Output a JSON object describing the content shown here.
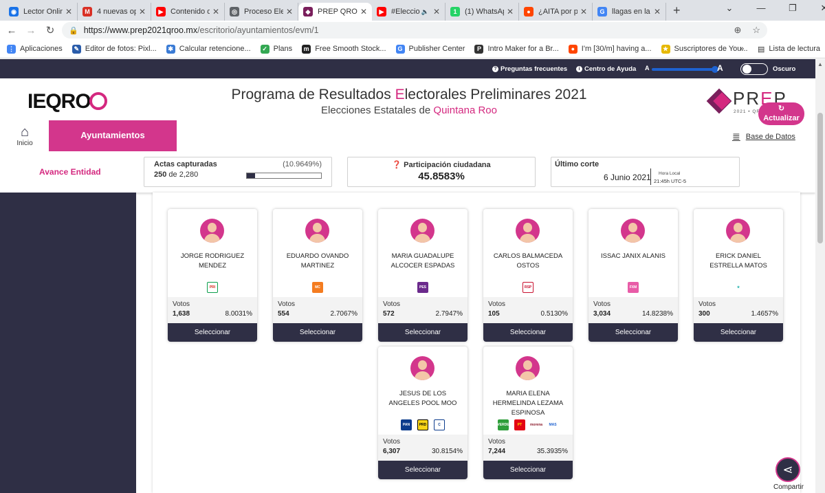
{
  "browser": {
    "tabs": [
      {
        "title": "Lector Onlin",
        "color": "#1a73e8",
        "glyph": "◉"
      },
      {
        "title": "4 nuevas op",
        "color": "#d93025",
        "glyph": "M"
      },
      {
        "title": "Contenido d",
        "color": "#ff0000",
        "glyph": "▶"
      },
      {
        "title": "Proceso Elec",
        "color": "#5f6368",
        "glyph": "◎"
      },
      {
        "title": "PREP QROO",
        "color": "#7a1f5c",
        "glyph": "◆",
        "active": true
      },
      {
        "title": "#Eleccio",
        "color": "#ff0000",
        "glyph": "▶",
        "audio": "🔈"
      },
      {
        "title": "(1) WhatsAp",
        "color": "#25d366",
        "glyph": "1"
      },
      {
        "title": "¿AITA por p",
        "color": "#ff4500",
        "glyph": "●"
      },
      {
        "title": "llagas en la",
        "color": "#4285f4",
        "glyph": "G"
      }
    ],
    "url_host": "https://www.prep2021qroo.mx",
    "url_path": "/escritorio/ayuntamientos/evm/1",
    "bookmarks": [
      {
        "label": "Aplicaciones",
        "color": "#4285f4",
        "glyph": "⋮"
      },
      {
        "label": "Editor de fotos: Pixl...",
        "color": "#2a5caa",
        "glyph": "✎"
      },
      {
        "label": "Calcular retencione...",
        "color": "#3a7bd5",
        "glyph": "✱"
      },
      {
        "label": "Plans",
        "color": "#34a853",
        "glyph": "✓"
      },
      {
        "label": "Free Smooth Stock...",
        "color": "#222222",
        "glyph": "m"
      },
      {
        "label": "Publisher Center",
        "color": "#4285f4",
        "glyph": "G"
      },
      {
        "label": "Intro Maker for a Br...",
        "color": "#333333",
        "glyph": "P"
      },
      {
        "label": "I'm [30/m] having a...",
        "color": "#ff4500",
        "glyph": "●"
      },
      {
        "label": "Suscriptores de You...",
        "color": "#e6b800",
        "glyph": "★"
      }
    ],
    "reading_list": "Lista de lectura"
  },
  "topbar": {
    "faq": "Preguntas frecuentes",
    "help": "Centro de Ayuda",
    "font_small": "A",
    "font_large": "A",
    "dark_mode": "Oscuro"
  },
  "header": {
    "logo_text": "IEQRO",
    "title_a": "Programa de Resultados ",
    "title_b": "E",
    "title_c": "lectorales Preliminares 2021",
    "subtitle_a": "Elecciones Estatales de ",
    "subtitle_b": "Quintana Roo",
    "prep_a": "PR",
    "prep_b": "E",
    "prep_c": "P",
    "prep_small": "2021 • QROO"
  },
  "nav": {
    "home": "Inicio",
    "ayuntamientos": "Ayuntamientos",
    "base_datos": "Base de Datos"
  },
  "status": {
    "avance": "Avance Entidad",
    "actas_label": "Actas capturadas",
    "actas_pct": "(10.9649%)",
    "actas_count": "250",
    "actas_de": " de ",
    "actas_total": "2,280",
    "actas_progress": 0.109649,
    "part_label": "Participación ciudadana",
    "part_value": "45.8583%",
    "corte_label": "Último corte",
    "corte_date": "6 Junio 2021",
    "hora_local": "Hora Local",
    "hora": "21:45h UTC-5",
    "actualizar": "Actualizar"
  },
  "candidates": [
    {
      "name": "JORGE RODRIGUEZ MENDEZ",
      "votes_label": "Votos",
      "votes": "1,638",
      "pct": "8.0031%",
      "select": "Seleccionar",
      "parties": [
        {
          "text": "PRI",
          "bg": "#ffffff",
          "fg": "#d52b1e",
          "border": "#0a9e4a"
        }
      ]
    },
    {
      "name": "EDUARDO OVANDO MARTINEZ",
      "votes_label": "Votos",
      "votes": "554",
      "pct": "2.7067%",
      "select": "Seleccionar",
      "parties": [
        {
          "text": "MC",
          "bg": "#f47c20",
          "fg": "#ffffff",
          "border": "#f47c20"
        }
      ]
    },
    {
      "name": "MARIA GUADALUPE ALCOCER ESPADAS",
      "votes_label": "Votos",
      "votes": "572",
      "pct": "2.7947%",
      "select": "Seleccionar",
      "parties": [
        {
          "text": "PES",
          "bg": "#6b2a8c",
          "fg": "#ffffff",
          "border": "#6b2a8c"
        }
      ]
    },
    {
      "name": "CARLOS BALMACEDA OSTOS",
      "votes_label": "Votos",
      "votes": "105",
      "pct": "0.5130%",
      "select": "Seleccionar",
      "parties": [
        {
          "text": "RSP",
          "bg": "#ffffff",
          "fg": "#c8102e",
          "border": "#c8102e"
        }
      ]
    },
    {
      "name": "ISSAC JANIX ALANIS",
      "votes_label": "Votos",
      "votes": "3,034",
      "pct": "14.8238%",
      "select": "Seleccionar",
      "parties": [
        {
          "text": "FXM",
          "bg": "#e85ca7",
          "fg": "#ffffff",
          "border": "#e85ca7"
        }
      ]
    },
    {
      "name": "ERICK DANIEL ESTRELLA MATOS",
      "votes_label": "Votos",
      "votes": "300",
      "pct": "1.4657%",
      "select": "Seleccionar",
      "parties": [
        {
          "text": "★",
          "bg": "#ffffff",
          "fg": "#2bb5b0",
          "border": "#ffffff"
        }
      ]
    },
    {
      "name": "JESUS DE LOS ANGELES POOL MOO",
      "votes_label": "Votos",
      "votes": "6,307",
      "pct": "30.8154%",
      "select": "Seleccionar",
      "parties": [
        {
          "text": "PAN",
          "bg": "#0b3b8c",
          "fg": "#ffffff",
          "border": "#0b3b8c"
        },
        {
          "text": "PRD",
          "bg": "#f7d417",
          "fg": "#000000",
          "border": "#000000"
        },
        {
          "text": "C",
          "bg": "#ffffff",
          "fg": "#0b3b8c",
          "border": "#0b3b8c"
        }
      ]
    },
    {
      "name": "MARIA ELENA HERMELINDA LEZAMA ESPINOSA",
      "votes_label": "Votos",
      "votes": "7,244",
      "pct": "35.3935%",
      "select": "Seleccionar",
      "parties": [
        {
          "text": "VERDE",
          "bg": "#2e9e3a",
          "fg": "#ffffff",
          "border": "#2e9e3a"
        },
        {
          "text": "PT",
          "bg": "#e30613",
          "fg": "#ffe600",
          "border": "#e30613"
        },
        {
          "text": "morena",
          "bg": "#ffffff",
          "fg": "#8b1a2b",
          "border": "#ffffff"
        },
        {
          "text": "MAS",
          "bg": "#ffffff",
          "fg": "#1e62d0",
          "border": "#ffffff"
        }
      ]
    }
  ],
  "share": "Compartir",
  "colors": {
    "brand_pink": "#d3368c",
    "navy": "#2f2f45"
  }
}
